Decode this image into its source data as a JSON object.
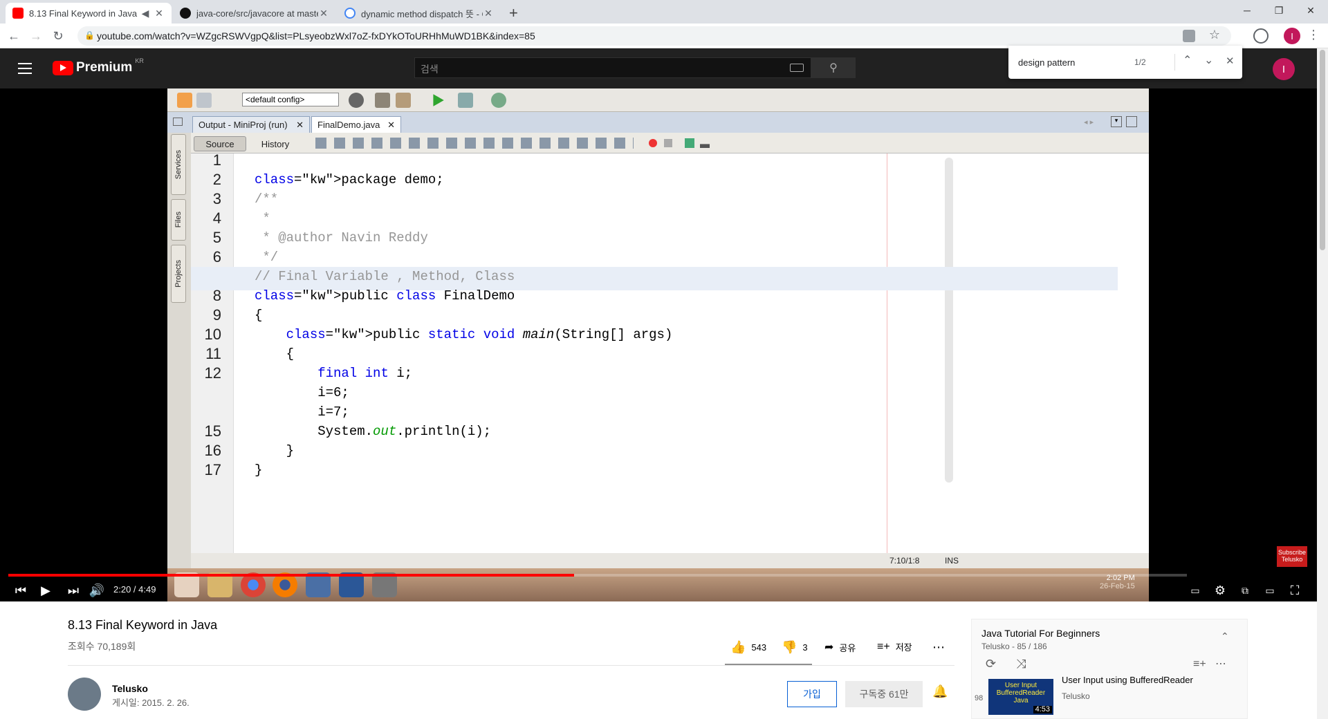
{
  "browser": {
    "tabs": [
      {
        "title": "8.13 Final Keyword in Java",
        "active": true
      },
      {
        "title": "java-core/src/javacore at master",
        "active": false
      },
      {
        "title": "dynamic method dispatch 뜻 - G",
        "active": false
      }
    ],
    "new_tab": "+",
    "url": "youtube.com/watch?v=WZgcRSWVgpQ&list=PLsyeobzWxl7oZ-fxDYkOToURHhMuWD1BK&index=85",
    "profile_initial": "I",
    "find": {
      "query": "design pattern",
      "count": "1/2"
    }
  },
  "youtube": {
    "brand": "Premium",
    "region": "KR",
    "search_placeholder": "검색",
    "avatar_initial": "I"
  },
  "ide": {
    "config": "<default config>",
    "tabs": [
      "Output - MiniProj (run)",
      "FinalDemo.java"
    ],
    "source_btn": "Source",
    "history_btn": "History",
    "side_tabs": [
      "Services",
      "Files",
      "Projects"
    ],
    "code": [
      {
        "n": "1",
        "t": ""
      },
      {
        "n": "2",
        "t": "package demo;"
      },
      {
        "n": "3",
        "t": "/**"
      },
      {
        "n": "4",
        "t": " *"
      },
      {
        "n": "5",
        "t": " * @author Navin Reddy"
      },
      {
        "n": "6",
        "t": " */"
      },
      {
        "n": "",
        "t": "// Final Variable , Method, Class"
      },
      {
        "n": "8",
        "t": "public class FinalDemo"
      },
      {
        "n": "9",
        "t": "{"
      },
      {
        "n": "10",
        "t": "    public static void main(String[] args)"
      },
      {
        "n": "11",
        "t": "    {"
      },
      {
        "n": "12",
        "t": "        final int i;"
      },
      {
        "n": "",
        "t": "        i=6;"
      },
      {
        "n": "",
        "t": "        i=7;"
      },
      {
        "n": "15",
        "t": "        System.out.println(i);"
      },
      {
        "n": "16",
        "t": "    }"
      },
      {
        "n": "17",
        "t": "}"
      }
    ],
    "cursor_pos": "7:10/1:8",
    "insert_mode": "INS",
    "tray_time": "2:02 PM",
    "tray_date": "26-Feb-15",
    "subscribe_badge": "Subscribe Telusko"
  },
  "player": {
    "time": "2:20 / 4:49",
    "progress": 0.48
  },
  "video_info": {
    "title": "8.13 Final Keyword in Java",
    "views": "조회수 70,189회",
    "likes": "543",
    "dislikes": "3",
    "share": "공유",
    "save": "저장",
    "channel": "Telusko",
    "published": "게시일: 2015. 2. 26.",
    "join": "가입",
    "subscribed": "구독중",
    "subs_count": "61만"
  },
  "playlist": {
    "title": "Java Tutorial For Beginners",
    "meta": "Telusko - 85 / 186",
    "item": {
      "index": "98",
      "title": "User Input using BufferedReader",
      "channel": "Telusko",
      "duration": "4:53",
      "thumb_text": "User Input BufferedReader Java"
    }
  },
  "colors": {
    "accent": "#ff0000",
    "tab_bg": "#dee1e6",
    "ide_keyword": "#0000e6",
    "ide_comment": "#969696"
  }
}
